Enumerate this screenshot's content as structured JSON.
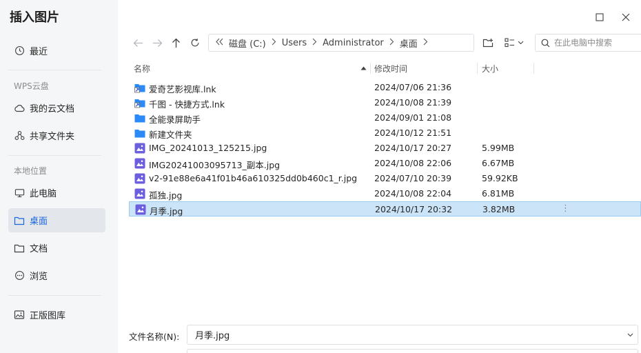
{
  "dialog": {
    "title": "插入图片"
  },
  "sidebar": {
    "recent": "最近",
    "cloud_header": "WPS云盘",
    "cloud_items": [
      "我的云文档",
      "共享文件夹"
    ],
    "local_header": "本地位置",
    "local_items": [
      "此电脑",
      "桌面",
      "文档",
      "浏览"
    ],
    "active_item": "桌面",
    "gallery": "正版图库"
  },
  "toolbar": {
    "breadcrumb": [
      "磁盘 (C:)",
      "Users",
      "Administrator",
      "桌面"
    ],
    "search_placeholder": "在此电脑中搜索"
  },
  "columns": {
    "name": "名称",
    "date": "修改时间",
    "size": "大小"
  },
  "files": [
    {
      "name": "爱奇艺影视库.lnk",
      "date": "2024/07/06 21:36",
      "size": "",
      "icon": "shortcut-folder-icon"
    },
    {
      "name": "千图 - 快捷方式.lnk",
      "date": "2024/10/08 21:39",
      "size": "",
      "icon": "shortcut-folder-icon"
    },
    {
      "name": "全能录屏助手",
      "date": "2024/09/01 21:08",
      "size": "",
      "icon": "folder-icon"
    },
    {
      "name": "新建文件夹",
      "date": "2024/10/12 21:51",
      "size": "",
      "icon": "folder-icon"
    },
    {
      "name": "IMG_20241013_125215.jpg",
      "date": "2024/10/17 20:27",
      "size": "5.99MB",
      "icon": "image-file-icon"
    },
    {
      "name": "IMG20241003095713_副本.jpg",
      "date": "2024/10/08 22:06",
      "size": "6.67MB",
      "icon": "image-file-icon"
    },
    {
      "name": "v2-91e88e6a41f01b46a610325dd0b460c1_r.jpg",
      "date": "2024/07/10 20:39",
      "size": "59.92KB",
      "icon": "image-file-icon"
    },
    {
      "name": "孤独.jpg",
      "date": "2024/10/08 22:04",
      "size": "6.81MB",
      "icon": "image-file-icon"
    },
    {
      "name": "月季.jpg",
      "date": "2024/10/17 20:32",
      "size": "3.82MB",
      "icon": "image-file-icon",
      "selected": true
    }
  ],
  "footer": {
    "filename_label": "文件名称(N):",
    "filename_value": "月季.jpg"
  },
  "colors": {
    "accent": "#1a66e0",
    "folder": "#2b8af7",
    "image_icon": "#6b5fe0",
    "selected_bg": "#cce4f7"
  }
}
